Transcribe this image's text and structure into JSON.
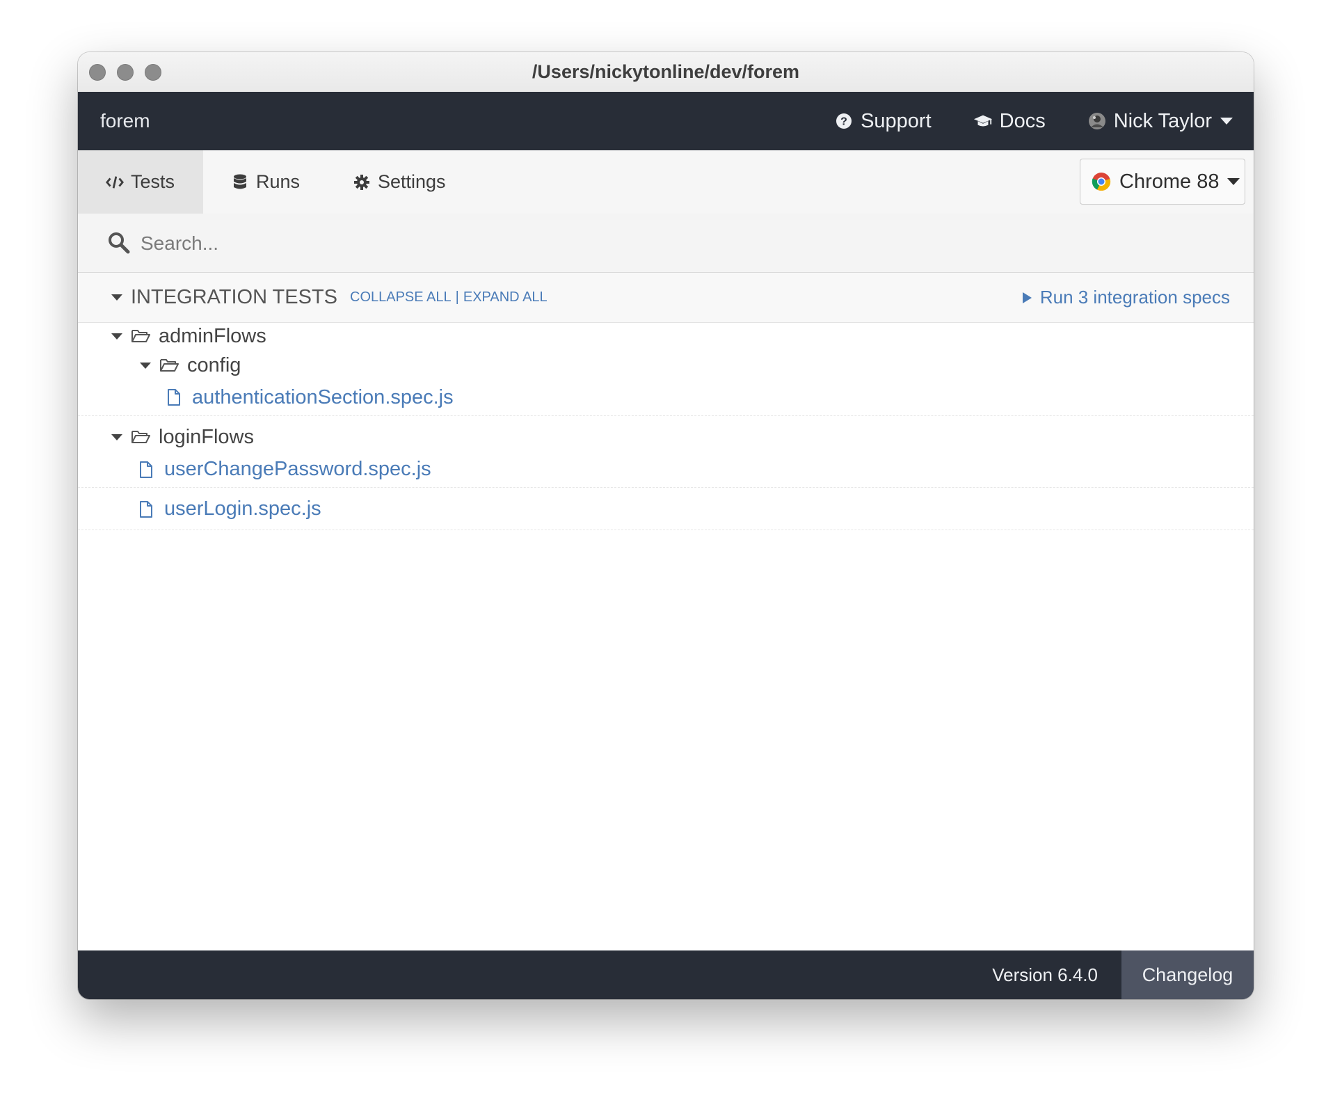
{
  "window": {
    "title": "/Users/nickytonline/dev/forem"
  },
  "topnav": {
    "project": "forem",
    "support": "Support",
    "docs": "Docs",
    "user": "Nick Taylor"
  },
  "tabs": [
    {
      "label": "Tests",
      "icon": "code-icon",
      "active": true
    },
    {
      "label": "Runs",
      "icon": "database-icon",
      "active": false
    },
    {
      "label": "Settings",
      "icon": "gear-icon",
      "active": false
    }
  ],
  "browser": {
    "label": "Chrome 88",
    "icon": "chrome-icon"
  },
  "search": {
    "placeholder": "Search...",
    "value": ""
  },
  "section": {
    "title": "INTEGRATION TESTS",
    "collapse_all": "COLLAPSE ALL",
    "separator": "|",
    "expand_all": "EXPAND ALL",
    "run_label": "Run 3 integration specs"
  },
  "tree": {
    "admin_folder": "adminFlows",
    "config_folder": "config",
    "spec_auth": "authenticationSection.spec.js",
    "login_folder": "loginFlows",
    "spec_change_password": "userChangePassword.spec.js",
    "spec_login": "userLogin.spec.js"
  },
  "footer": {
    "version": "Version 6.4.0",
    "changelog": "Changelog"
  },
  "colors": {
    "nav_bg": "#282d37",
    "link_blue": "#4a7bb7",
    "changelog_bg": "#4e5463"
  }
}
